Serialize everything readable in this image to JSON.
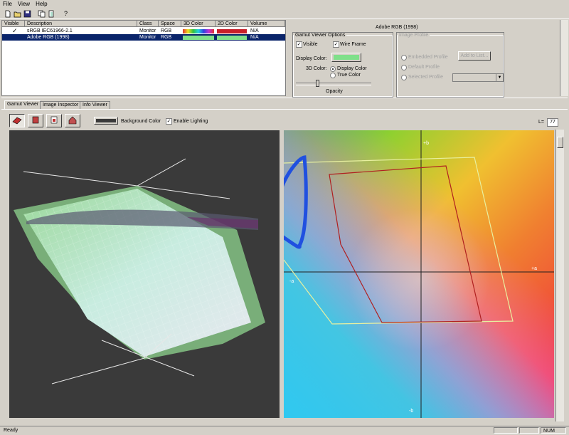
{
  "menu": [
    "File",
    "View",
    "Help"
  ],
  "toolbar": {
    "icons": [
      "new-file-icon",
      "open-folder-icon",
      "save-icon",
      "copy-icon",
      "document-icon",
      "help-icon"
    ],
    "help_label": "?"
  },
  "profile_list": {
    "columns": [
      "Visible",
      "Description",
      "Class",
      "Space",
      "3D Color",
      "2D Color",
      "Volume"
    ],
    "rows": [
      {
        "visible": "✓",
        "description": "sRGB IEC61966-2.1",
        "class": "Monitor",
        "space": "RGB",
        "color3d": "rainbow",
        "color2d": "#c8202a",
        "volume": "N/A"
      },
      {
        "visible": "",
        "description": "Adobe RGB (1998)",
        "class": "Monitor",
        "space": "RGB",
        "color3d": "#7fe08a",
        "color2d": "#7fe08a",
        "volume": "N/A"
      }
    ]
  },
  "panel": {
    "title": "Adobe RGB (1998)",
    "gamut_options": {
      "legend": "Gamut Viewer Options",
      "visible": "Visible",
      "wire_frame": "Wire Frame",
      "display_color": "Display Color:",
      "display_color_value": "#7fe08a",
      "color3d": "3D Color:",
      "opt_display": "Display Color",
      "opt_true": "True Color",
      "opacity": "Opacity"
    },
    "image_profile": {
      "legend": "Image Profile",
      "embedded": "Embedded Profile",
      "default": "Default Profile",
      "selected": "Selected Profile",
      "add_button": "Add to List..."
    }
  },
  "viewer": {
    "tabs": [
      "Gamut Viewer",
      "Image Inspector",
      "Info Viewer"
    ],
    "view_icons": [
      "gamut-3d-icon",
      "cylinder-view-icon",
      "page-view-icon",
      "house-view-icon"
    ],
    "background_color": "Background Color",
    "enable_lighting": "Enable Lighting",
    "l_label": "L=",
    "l_value": "77",
    "axes": {
      "plus_b": "+b",
      "minus_b": "-b",
      "plus_a": "+a",
      "minus_a": "-a"
    }
  },
  "status": {
    "ready": "Ready",
    "num": "NUM"
  }
}
